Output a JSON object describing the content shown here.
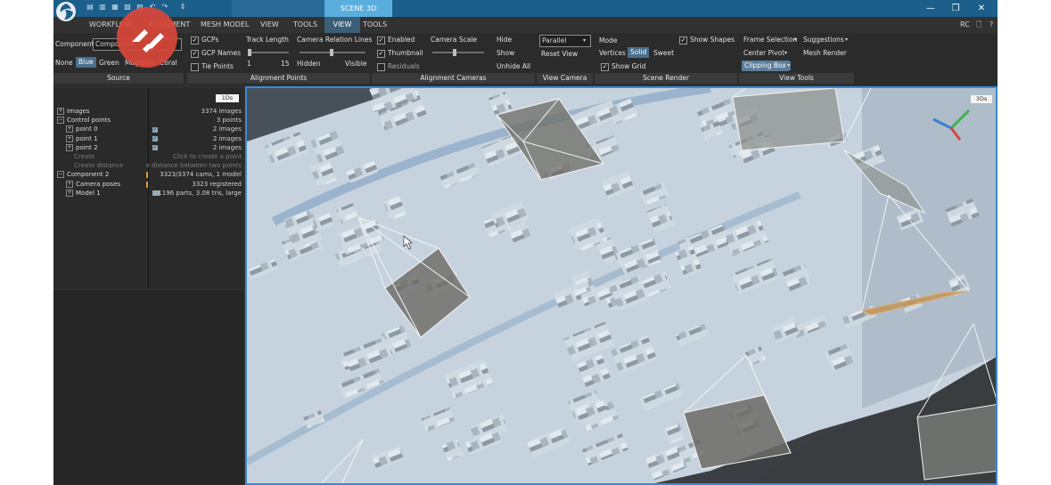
{
  "titlebar": {
    "doc_tabs": [
      "",
      "SCENE 3D"
    ],
    "window_title": "",
    "quick_access_icons": [
      "layout-1-icon",
      "layout-2-icon",
      "layout-3-icon",
      "layout-4-icon",
      "layout-5-icon",
      "undo-icon",
      "redo-icon",
      "pin-icon"
    ],
    "window_controls": {
      "minimize": "—",
      "restore": "❐",
      "close": "✕"
    }
  },
  "menu": {
    "items": [
      "WORKFLOW",
      "ALIGNMENT",
      "MESH MODEL",
      "VIEW",
      "TOOLS",
      "VIEW",
      "TOOLS"
    ],
    "selected_index": 5,
    "right": {
      "rc": "RC",
      "icon1": "🗋",
      "help": "?"
    }
  },
  "ribbon": {
    "source": {
      "component_label": "Component",
      "component_value": "Component",
      "colors": [
        "None",
        "Blue",
        "Green",
        "Magenta",
        "Coral"
      ],
      "selected_color": "Blue",
      "group": "Source"
    },
    "alignment_points": {
      "gcps": "GCPs",
      "gcp_names": "GCP Names",
      "tie_points": "Tie Points",
      "track_length": "Track Length",
      "track_min": "1",
      "track_max": "15",
      "relation_lines": "Camera Relation Lines",
      "hidden": "Hidden",
      "visible": "Visible",
      "group": "Alignment Points"
    },
    "alignment_cameras": {
      "enabled": "Enabled",
      "thumbnail": "Thumbnail",
      "residuals": "Residuals",
      "camera_scale": "Camera Scale",
      "hide": "Hide",
      "show": "Show",
      "unhide_all": "Unhide All",
      "group": "Alignment Cameras"
    },
    "view_camera": {
      "projection": "Parallel",
      "reset": "Reset View",
      "group": "View Camera"
    },
    "scene_render": {
      "mode": "Mode",
      "vertices": "Vertices",
      "solid": "Solid",
      "sweet": "Sweet",
      "show_grid": "Show Grid",
      "show_shapes": "Show Shapes",
      "group": "Scene Render"
    },
    "view_tools": {
      "frame_selection": "Frame Selection",
      "suggestions": "Suggestions",
      "center_pivot": "Center Pivot",
      "mesh_render": "Mesh Render",
      "clipping_box": "Clipping Box",
      "group": "View Tools"
    }
  },
  "tree": {
    "header_badge": "1Ds",
    "rows": [
      {
        "label": "Images",
        "value": "3374 images",
        "indent": 0,
        "expander": "+"
      },
      {
        "label": "Control points",
        "value": "3 points",
        "indent": 0,
        "expander": "−"
      },
      {
        "label": "point 0",
        "value": "2 images",
        "indent": 1,
        "expander": "+"
      },
      {
        "label": "point 1",
        "value": "2 images",
        "indent": 1,
        "expander": "+"
      },
      {
        "label": "point 2",
        "value": "2 images",
        "indent": 1,
        "expander": "+"
      },
      {
        "label": "Create",
        "value": "Click to create a point",
        "indent": 1,
        "expander": ""
      },
      {
        "label": "Create distance",
        "value": "e distance between two points",
        "indent": 1,
        "expander": ""
      },
      {
        "label": "Component 2",
        "value": "3323/3374 cams, 1 model",
        "indent": 0,
        "expander": "−"
      },
      {
        "label": "Camera poses",
        "value": "3323 registered",
        "indent": 1,
        "expander": "+"
      },
      {
        "label": "Model 1",
        "value": "1196 parts, 3.08 tris, large",
        "indent": 1,
        "expander": "+"
      }
    ]
  },
  "view3d": {
    "badge": "3Ds"
  },
  "colors": {
    "titlebar": "#1c5f8b",
    "accent": "#3a8ad6",
    "selected_tab": "#5aaede",
    "overlay_red": "#d9463a"
  }
}
